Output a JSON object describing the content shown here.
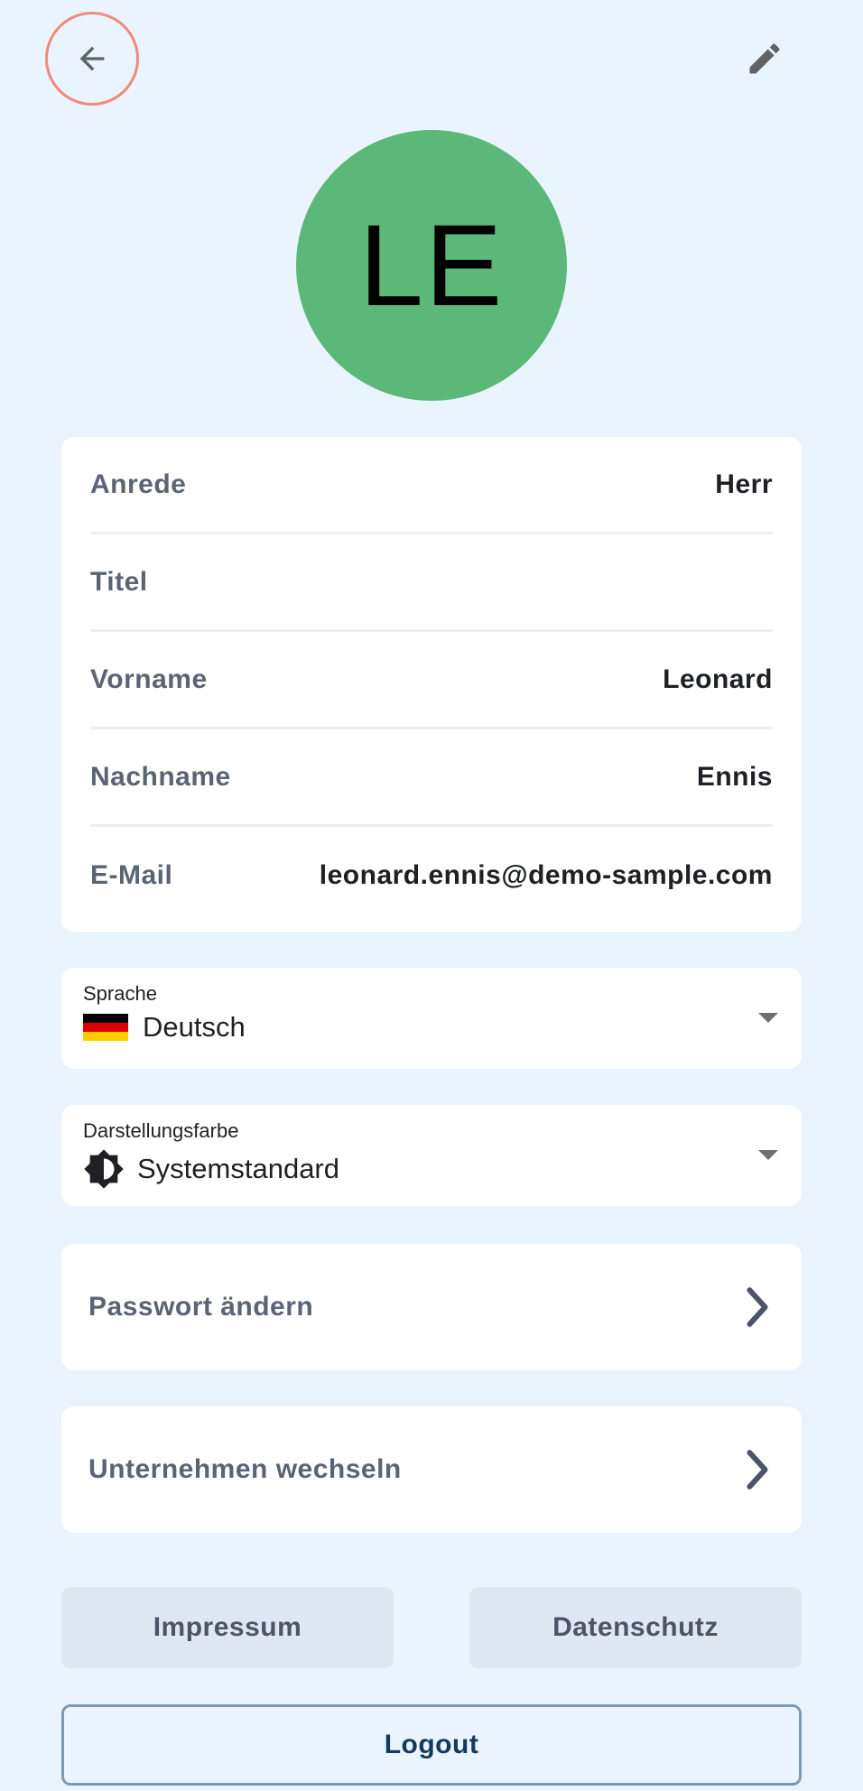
{
  "header": {
    "back_icon": "arrow-left-icon",
    "edit_icon": "pencil-icon"
  },
  "avatar": {
    "initials": "LE",
    "color": "#5CB879"
  },
  "profile": {
    "rows": [
      {
        "label": "Anrede",
        "value": "Herr"
      },
      {
        "label": "Titel",
        "value": ""
      },
      {
        "label": "Vorname",
        "value": "Leonard"
      },
      {
        "label": "Nachname",
        "value": "Ennis"
      },
      {
        "label": "E-Mail",
        "value": "leonard.ennis@demo-sample.com"
      }
    ]
  },
  "language": {
    "label": "Sprache",
    "value": "Deutsch",
    "icon": "german-flag-icon"
  },
  "theme": {
    "label": "Darstellungsfarbe",
    "value": "Systemstandard",
    "icon": "brightness-icon"
  },
  "actions": {
    "change_password": "Passwort ändern",
    "switch_company": "Unternehmen wechseln"
  },
  "footer": {
    "impressum": "Impressum",
    "datenschutz": "Datenschutz",
    "logout": "Logout"
  },
  "colors": {
    "background": "#EAF4FE",
    "back_ring": "#F08A7C",
    "label_text": "#5B6475",
    "logout_text": "#163A5F"
  }
}
